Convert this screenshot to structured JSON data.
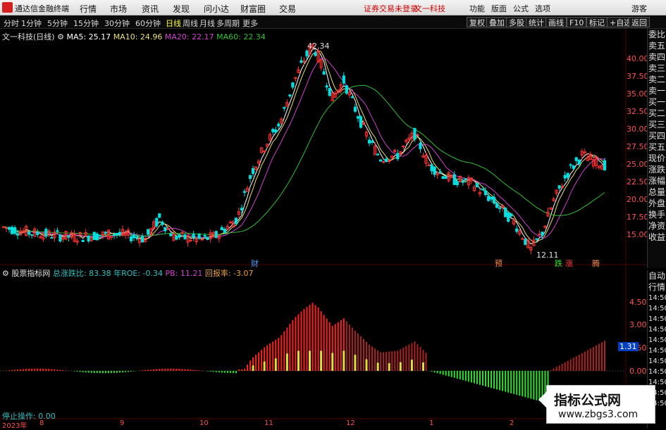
{
  "titlebar": {
    "app_name": "通达信金融终端",
    "menus": [
      "行情",
      "市场",
      "资讯",
      "发现",
      "问小达",
      "财富圈",
      "交易"
    ],
    "notice": "证券交易未登录",
    "stock_name": "文一科技",
    "right_menus": [
      "功能",
      "版面",
      "公式",
      "选项"
    ],
    "guest": "游客"
  },
  "toolbar": {
    "periods": [
      "分时",
      "1分钟",
      "5分钟",
      "15分钟",
      "30分钟",
      "60分钟",
      "日线",
      "周线",
      "月线",
      "多周期",
      "更多"
    ],
    "active_period": "日线",
    "right_buttons": [
      "复权",
      "叠加",
      "多股",
      "统计",
      "画线",
      "F10",
      "标记",
      "+自选",
      "返回"
    ]
  },
  "main_chart": {
    "title": "文一科技(日线)",
    "ma5": "MA5: 25.17",
    "ma10": "MA10: 24.96",
    "ma20": "MA20: 22.17",
    "ma60": "MA60: 22.34",
    "high_label": "42.34",
    "low_label": "12.11",
    "event_labels": [
      "财",
      "预",
      "跌",
      "涨",
      "腾"
    ],
    "price_ticks": [
      "40.00",
      "37.50",
      "35.00",
      "32.50",
      "30.00",
      "27.50",
      "25.00",
      "22.50",
      "20.00",
      "17.50",
      "15.00"
    ],
    "colors": {
      "up": "#ff3232",
      "down": "#00e0e0",
      "ma5": "#ffffff",
      "ma10": "#e8e070",
      "ma20": "#d040d0",
      "ma60": "#30c030"
    }
  },
  "indicator": {
    "name": "股票指标网",
    "ratio": "总涨跌比: 83.38",
    "roe": "年ROE: -0.34",
    "pb": "PB: 11.21",
    "payback": "回报率: -3.07",
    "ticks": [
      "4.50",
      "3.00",
      "1.50",
      "0.00"
    ],
    "current_value": "1.31",
    "stop_label": "停止操作: 0.00"
  },
  "right_panel": {
    "items": [
      "委比",
      "卖五",
      "卖四",
      "卖三",
      "卖二",
      "卖一",
      "买一",
      "买二",
      "买三",
      "买四",
      "买五",
      "现价",
      "涨跌",
      "涨幅",
      "总量",
      "外盘",
      "换手",
      "净资",
      "收益"
    ],
    "bottom_tabs": [
      "自动",
      "行情"
    ],
    "times": [
      "14:50",
      "14:50",
      "14:50",
      "14:50",
      "14:50",
      "14:50",
      "14:50",
      "14:50",
      "14:50",
      "14:50",
      "14:50"
    ]
  },
  "date_axis": [
    "2023年",
    "8",
    "9",
    "10",
    "11",
    "12",
    "1",
    "2"
  ],
  "watermark": {
    "line1": "指标公式网",
    "line2": "www.zbgs3.com"
  }
}
